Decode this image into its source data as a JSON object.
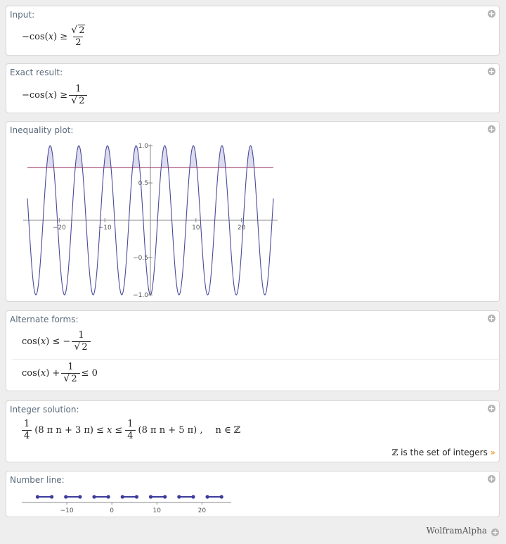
{
  "pods": {
    "input": {
      "title": "Input:"
    },
    "exact": {
      "title": "Exact result:"
    },
    "plot": {
      "title": "Inequality plot:"
    },
    "alternate": {
      "title": "Alternate forms:"
    },
    "integer": {
      "title": "Integer solution:"
    },
    "numberline": {
      "title": "Number line:"
    }
  },
  "expressions": {
    "input": {
      "lhs": "−cos(",
      "var": "x",
      "rhs": ") ≥",
      "num": "2",
      "den": "2"
    },
    "exact": {
      "lhs": "−cos(",
      "var": "x",
      "rhs": ") ≥",
      "num": "1",
      "den": "2"
    },
    "alt1": {
      "lhs": "cos(",
      "var": "x",
      "rhs": ") ≤ −",
      "num": "1",
      "den": "2"
    },
    "alt2": {
      "lhs": "cos(",
      "var": "x",
      "mid": ") +",
      "num": "1",
      "den": "2",
      "rhs": "≤ 0"
    },
    "integer": {
      "frac_num": "1",
      "frac_den": "4",
      "left_expr": "(8 π n + 3 π) ≤",
      "var": "x",
      "right_expr": "(8 π n + 5 π) ,",
      "cond": "n ∈ ℤ"
    }
  },
  "integers_note": {
    "symbol": "ℤ",
    "text": " is the set of integers",
    "more": "»"
  },
  "footer": {
    "brand": "WolframAlpha"
  },
  "plus_symbol": "+",
  "chart_data": [
    {
      "type": "line",
      "x_range": [
        -27,
        27
      ],
      "ylim": [
        -1.0,
        1.0
      ],
      "x_ticks": [
        -20,
        -10,
        10,
        20
      ],
      "y_ticks": [
        1.0,
        0.5,
        -0.5,
        -1.0
      ],
      "x_tick_labels": [
        "−20",
        "−10",
        "10",
        "20"
      ],
      "y_tick_labels": [
        "1.0",
        "0.5",
        "−0.5",
        "−1.0"
      ],
      "series": [
        {
          "function": "-cos(x)",
          "color": "#4a4a9a"
        },
        {
          "function": "sqrt(2)/2",
          "value": 0.7071,
          "color": "#9b3f6a"
        }
      ],
      "fill_color": "#dcdcf0",
      "grid": false
    },
    {
      "type": "scatter",
      "x_ticks": [
        -10,
        0,
        10,
        20
      ],
      "x_tick_labels": [
        "−10",
        "0",
        "10",
        "20"
      ],
      "intervals": [
        [
          -16.493,
          -13.352
        ],
        [
          -10.21,
          -7.069
        ],
        [
          -3.927,
          -0.785
        ],
        [
          2.356,
          5.498
        ],
        [
          8.639,
          11.781
        ],
        [
          14.923,
          18.064
        ],
        [
          21.206,
          24.347
        ]
      ],
      "color": "#3b3b9c"
    }
  ]
}
